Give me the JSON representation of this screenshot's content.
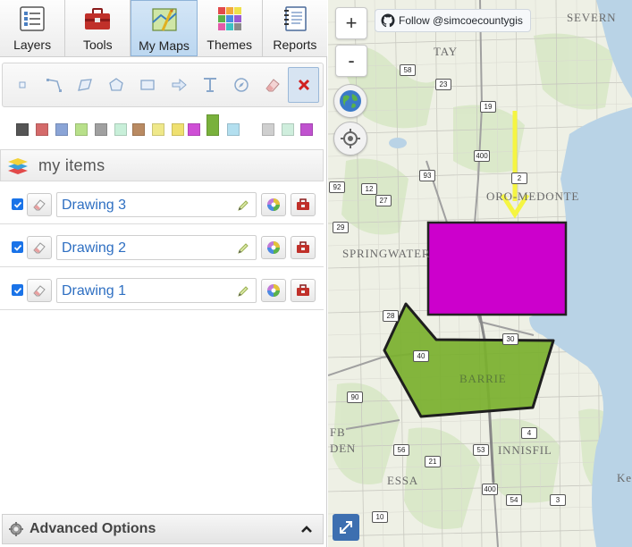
{
  "tabs": [
    {
      "label": "Layers",
      "icon": "layers-list-icon"
    },
    {
      "label": "Tools",
      "icon": "toolbox-icon"
    },
    {
      "label": "My Maps",
      "icon": "my-maps-icon",
      "active": true
    },
    {
      "label": "Themes",
      "icon": "themes-grid-icon"
    },
    {
      "label": "Reports",
      "icon": "reports-notebook-icon"
    }
  ],
  "draw_tools": [
    "point-tool-icon",
    "line-tool-icon",
    "freehand-tool-icon",
    "polygon-tool-icon",
    "rectangle-tool-icon",
    "arrow-tool-icon",
    "text-tool-icon",
    "measure-tool-icon",
    "eraser-tool-icon",
    "cancel-tool-icon"
  ],
  "color_swatches": [
    {
      "color": "#555555"
    },
    {
      "color": "#d46a6a"
    },
    {
      "color": "#8aa4d6"
    },
    {
      "color": "#b8e08a"
    },
    {
      "color": "#a0a0a0"
    },
    {
      "color": "#c8efd9"
    },
    {
      "color": "#b98a62"
    },
    {
      "color": "#efe88a"
    },
    {
      "color": "#efe070"
    },
    {
      "color": "#cf4fd6"
    },
    {
      "color": "#79b13c",
      "selected": true
    },
    {
      "color": "#b3dfef"
    },
    {
      "color": "#cfcfcf"
    },
    {
      "color": "#cfeedd"
    },
    {
      "color": "#c052cf"
    }
  ],
  "my_items": {
    "title": "my items",
    "items": [
      {
        "name": "Drawing 3",
        "checked": true
      },
      {
        "name": "Drawing 2",
        "checked": true
      },
      {
        "name": "Drawing 1",
        "checked": true
      }
    ]
  },
  "advanced": {
    "label": "Advanced Options"
  },
  "map": {
    "zoom_in": "+",
    "zoom_out": "-",
    "follow_label": "Follow @simcoecountygis",
    "places": [
      {
        "name": "TAY"
      },
      {
        "name": "SEVERN"
      },
      {
        "name": "ORO-MEDONTE"
      },
      {
        "name": "SPRINGWATER"
      },
      {
        "name": "BARRIE"
      },
      {
        "name": "INNISFIL"
      },
      {
        "name": "ESSA"
      },
      {
        "name": "FB"
      },
      {
        "name": "DEN"
      },
      {
        "name": "Kes"
      }
    ],
    "roads": [
      "58",
      "23",
      "19",
      "400",
      "93",
      "12",
      "27",
      "92",
      "29",
      "28",
      "40",
      "90",
      "56",
      "21",
      "53",
      "4",
      "400",
      "54",
      "3",
      "10",
      "2",
      "30"
    ]
  },
  "colors": {
    "drawing_purple": "#cc00cc",
    "drawing_green": "#79b02e",
    "arrow_yellow": "#f5f542",
    "water": "#b9d3e6",
    "accent_blue": "#1a73e8"
  }
}
